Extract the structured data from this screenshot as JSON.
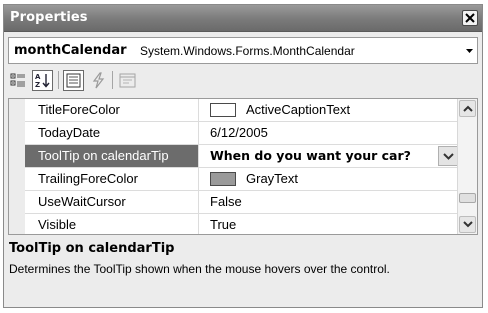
{
  "window": {
    "title": "Properties"
  },
  "object_selector": {
    "name": "monthCalendar",
    "type": "System.Windows.Forms.MonthCalendar"
  },
  "toolbar": {
    "buttons": [
      {
        "icon": "categorized-icon",
        "pressed": false
      },
      {
        "icon": "alphabetical-icon",
        "pressed": true
      },
      {
        "icon": "properties-icon",
        "pressed": true
      },
      {
        "icon": "events-icon",
        "pressed": false
      },
      {
        "icon": "property-pages-icon",
        "pressed": false
      }
    ]
  },
  "properties": [
    {
      "name": "TitleForeColor",
      "value": "ActiveCaptionText",
      "swatch": "#ffffff"
    },
    {
      "name": "TodayDate",
      "value": "6/12/2005"
    },
    {
      "name": "ToolTip on calendarTip",
      "value": "When do you want your car?",
      "selected": true
    },
    {
      "name": "TrailingForeColor",
      "value": "GrayText",
      "swatch": "#9a9a9a"
    },
    {
      "name": "UseWaitCursor",
      "value": "False"
    },
    {
      "name": "Visible",
      "value": "True"
    }
  ],
  "description": {
    "title": "ToolTip on calendarTip",
    "text": "Determines the ToolTip shown when the mouse hovers over the control."
  },
  "colors": {
    "titlebar": "#7a7a7a",
    "selected_row": "#6c6c6c",
    "panel": "#ececec"
  }
}
